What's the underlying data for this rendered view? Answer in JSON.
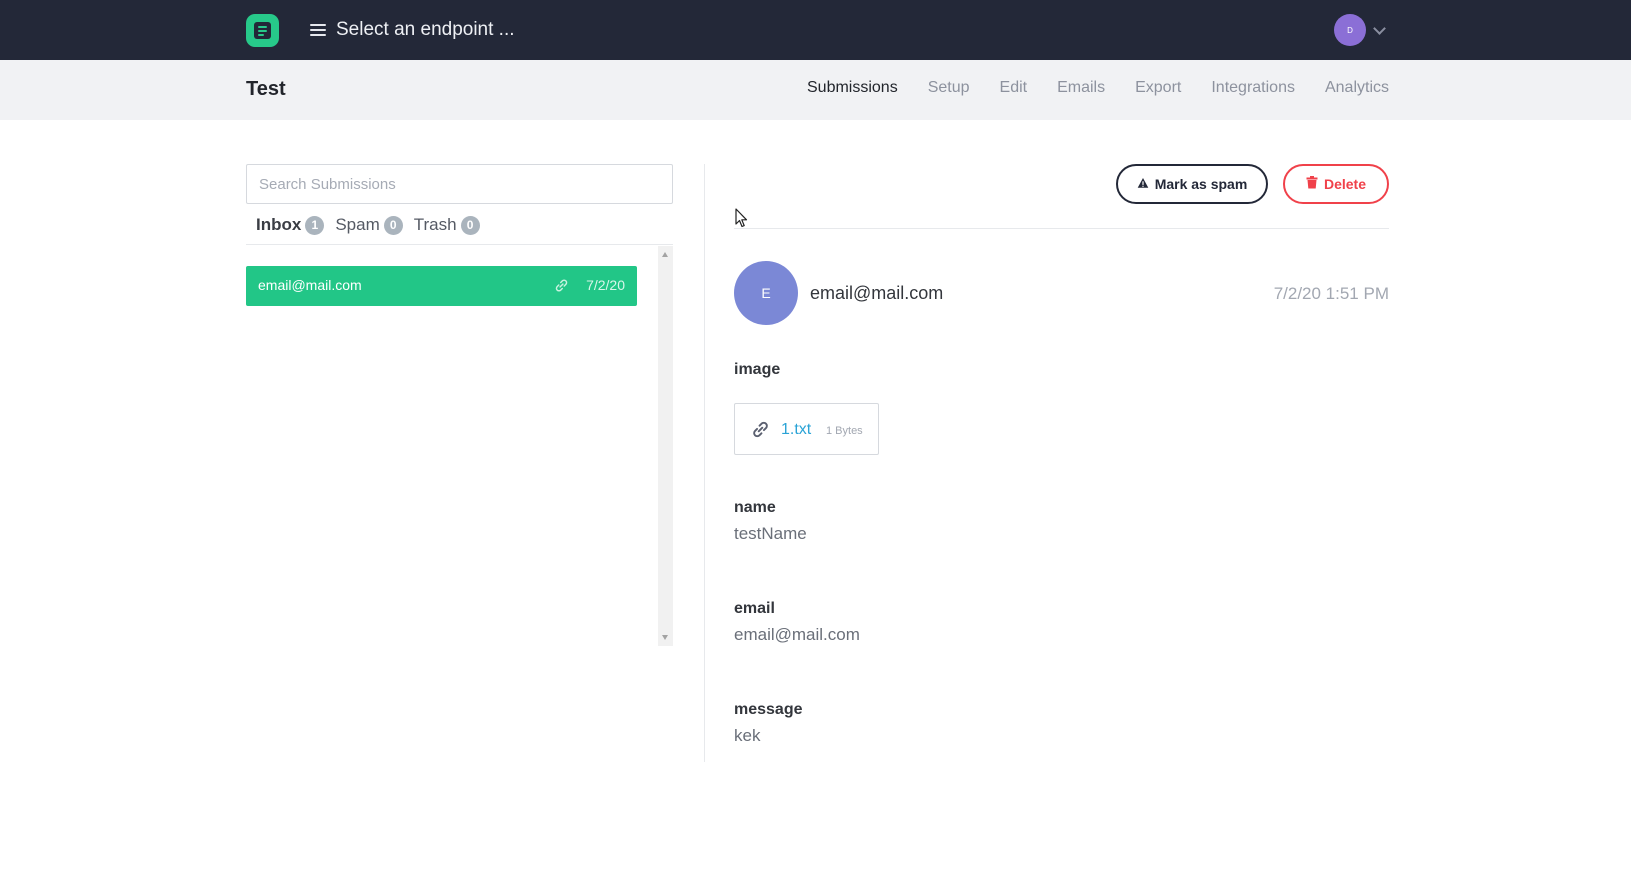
{
  "topbar": {
    "endpoint_select_label": "Select an endpoint ...",
    "user_initial": "D",
    "colors": {
      "background": "#232838",
      "logo": "#27c98a",
      "avatar": "#8b6fd6"
    }
  },
  "form": {
    "title": "Test",
    "tabs": [
      {
        "label": "Submissions",
        "active": true
      },
      {
        "label": "Setup",
        "active": false
      },
      {
        "label": "Edit",
        "active": false
      },
      {
        "label": "Emails",
        "active": false
      },
      {
        "label": "Export",
        "active": false
      },
      {
        "label": "Integrations",
        "active": false
      },
      {
        "label": "Analytics",
        "active": false
      }
    ]
  },
  "sidebar": {
    "search_placeholder": "Search Submissions",
    "folders": [
      {
        "label": "Inbox",
        "count": "1",
        "active": true
      },
      {
        "label": "Spam",
        "count": "0",
        "active": false
      },
      {
        "label": "Trash",
        "count": "0",
        "active": false
      }
    ],
    "submissions": [
      {
        "from": "email@mail.com",
        "date": "7/2/20",
        "has_attachment": true,
        "selected": true,
        "color": "#22c687"
      }
    ]
  },
  "detail": {
    "actions": {
      "spam_label": "Mark as spam",
      "delete_label": "Delete",
      "delete_color": "#f0414a"
    },
    "sender": {
      "initial": "E",
      "email": "email@mail.com",
      "date": "7/2/20 1:51 PM",
      "avatar_color": "#7b88d6"
    },
    "fields": {
      "image": {
        "label": "image",
        "file_name": "1.txt",
        "file_size": "1 Bytes"
      },
      "name": {
        "label": "name",
        "value": "testName"
      },
      "email": {
        "label": "email",
        "value": "email@mail.com"
      },
      "message": {
        "label": "message",
        "value": "kek"
      }
    }
  }
}
